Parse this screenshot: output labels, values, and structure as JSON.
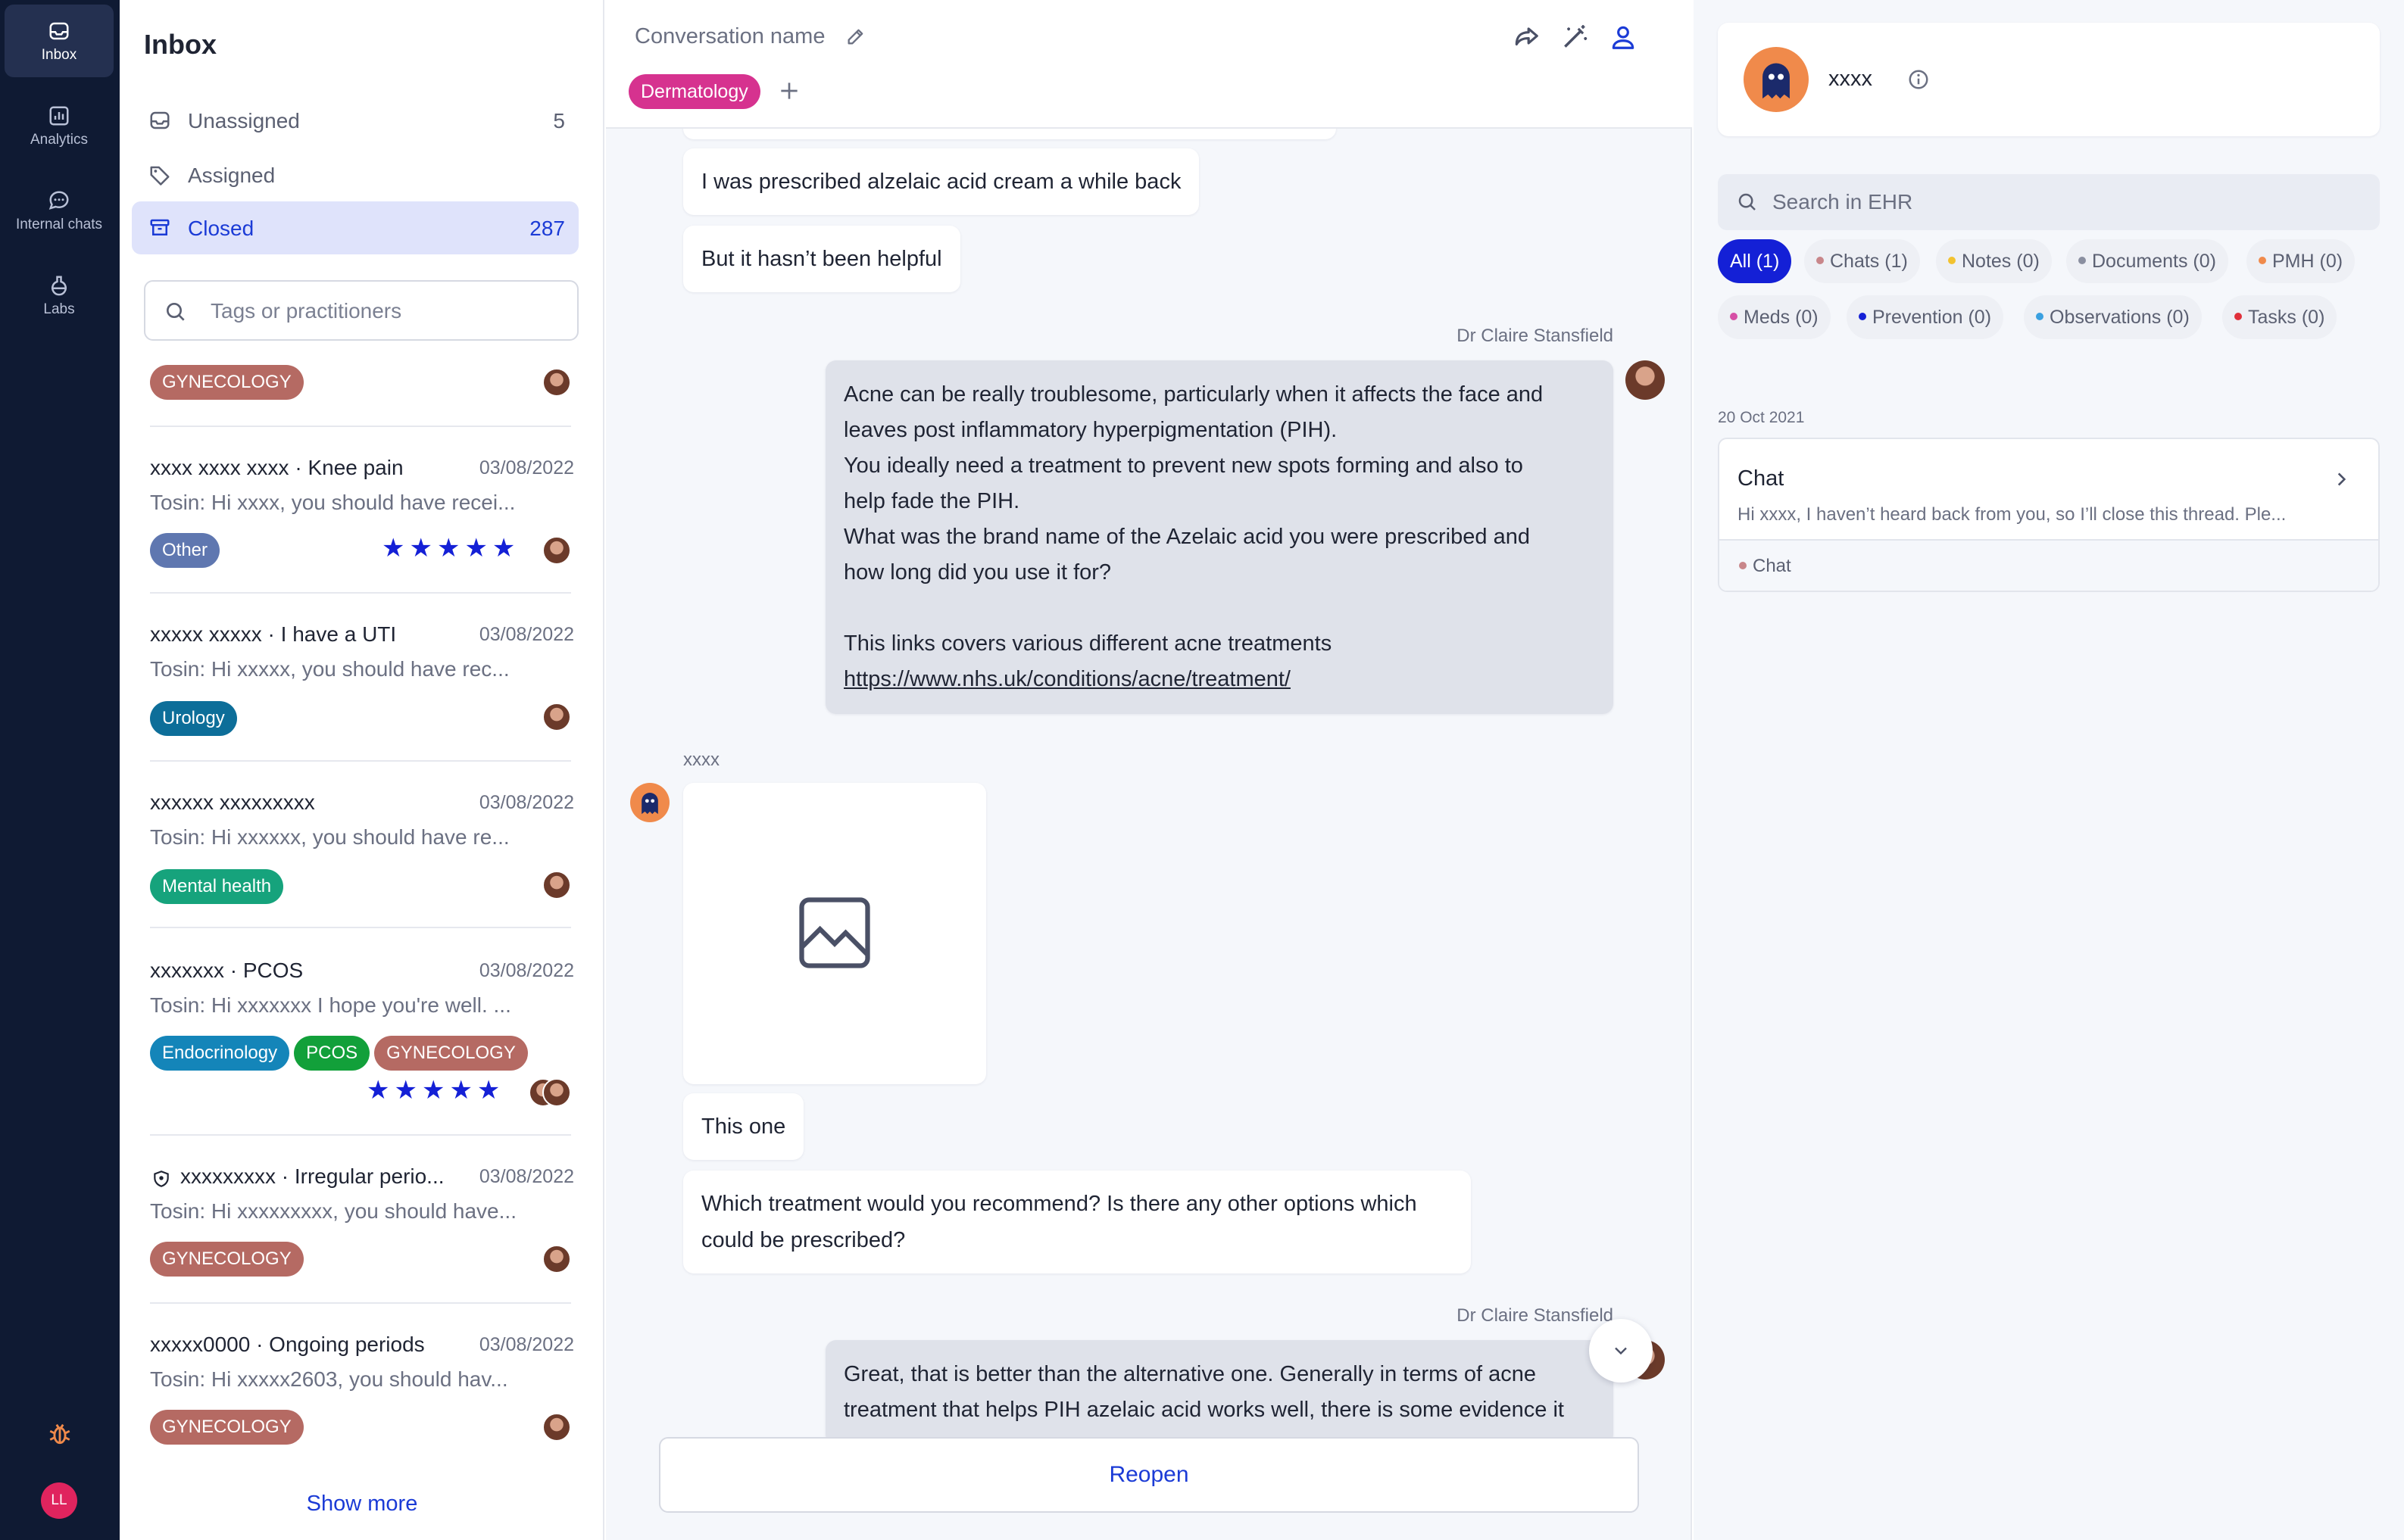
{
  "nav": {
    "items": [
      {
        "label": "Inbox",
        "icon": "inbox-icon",
        "active": true
      },
      {
        "label": "Analytics",
        "icon": "analytics-icon",
        "active": false
      },
      {
        "label": "Internal chats",
        "icon": "chat-bubble-icon",
        "active": false
      },
      {
        "label": "Labs",
        "icon": "flask-icon",
        "active": false
      }
    ],
    "user_initials": "LL",
    "colors": {
      "background": "#0f1a33",
      "active": "#243050",
      "avatar": "#e0245e"
    }
  },
  "inbox": {
    "title": "Inbox",
    "folders": [
      {
        "label": "Unassigned",
        "count": "5",
        "active": false
      },
      {
        "label": "Assigned",
        "count": "",
        "active": false
      },
      {
        "label": "Closed",
        "count": "287",
        "active": true
      }
    ],
    "search_placeholder": "Tags or practitioners",
    "top_partial_tag": "GYNECOLOGY",
    "conversations": [
      {
        "name": "xxxx xxxx xxxx · Knee pain",
        "date": "03/08/2022",
        "preview": "Tosin: Hi xxxx, you should have recei...",
        "tags": [
          "Other"
        ],
        "stars": "★★★★★"
      },
      {
        "name": "xxxxx xxxxx · I have a UTI",
        "date": "03/08/2022",
        "preview": "Tosin: Hi xxxxx, you should have rec...",
        "tags": [
          "Urology"
        ],
        "stars": ""
      },
      {
        "name": "xxxxxx xxxxxxxxx",
        "date": "03/08/2022",
        "preview": "Tosin: Hi xxxxxx, you should have re...",
        "tags": [
          "Mental health"
        ],
        "stars": ""
      },
      {
        "name": "xxxxxxx · PCOS",
        "date": "03/08/2022",
        "preview": "Tosin: Hi xxxxxxx I hope you're well. ...",
        "tags": [
          "Endocrinology",
          "PCOS",
          "GYNECOLOGY"
        ],
        "stars": "★★★★★"
      },
      {
        "name": "xxxxxxxxx · Irregular perio...",
        "date": "03/08/2022",
        "preview": "Tosin: Hi xxxxxxxxx, you should have...",
        "tags": [
          "GYNECOLOGY"
        ],
        "stars": ""
      },
      {
        "name": "xxxxx0000 · Ongoing periods",
        "date": "03/08/2022",
        "preview": "Tosin: Hi xxxxx2603, you should hav...",
        "tags": [
          "GYNECOLOGY"
        ],
        "stars": ""
      }
    ],
    "show_more": "Show more",
    "tag_colors": {
      "GYNECOLOGY": "#b56a63",
      "Other": "#5f77b0",
      "Urology": "#0d6e99",
      "Mental health": "#16a37c",
      "Endocrinology": "#1485b9",
      "PCOS": "#12a03a"
    }
  },
  "conversation": {
    "name": "Conversation name",
    "tag": "Dermatology",
    "tag_color": "#d6328f",
    "header_icons": [
      "share-icon",
      "magic-wand-icon",
      "user-icon"
    ],
    "messages": {
      "m1": "I was prescribed alzelaic acid cream a while back",
      "m2": "But it hasn’t been helpful",
      "doctor1_name": "Dr Claire Stansfield",
      "doctor1_lines": [
        "Acne can be really troublesome, particularly when it affects the face and",
        "leaves post inflammatory hyperpigmentation (PIH).",
        "You ideally need a treatment to prevent new spots forming and also to",
        "help fade the PIH.",
        "What was the brand name of the Azelaic acid you were prescribed and",
        "how long did you use it for?",
        "",
        "This links covers various different acne treatments"
      ],
      "doctor1_link": "https://www.nhs.uk/conditions/acne/treatment/",
      "patient_name": "xxxx",
      "m3": "This one",
      "m4_lines": [
        "Which treatment would you recommend? Is there any other options which",
        "could be prescribed?"
      ],
      "doctor2_name": "Dr Claire Stansfield",
      "doctor2_lines": [
        "Great, that is better than the alternative one. Generally in terms of acne",
        "treatment that helps PIH azelaic acid works well, there is some evidence it"
      ]
    },
    "reopen_label": "Reopen"
  },
  "ehr": {
    "patient_name": "xxxx",
    "search_placeholder": "Search in EHR",
    "filters": [
      {
        "label": "All (1)",
        "active": true,
        "dot": ""
      },
      {
        "label": "Chats (1)",
        "active": false,
        "dot": "#c8868a"
      },
      {
        "label": "Notes (0)",
        "active": false,
        "dot": "#f2c230"
      },
      {
        "label": "Documents (0)",
        "active": false,
        "dot": "#8a8fa0"
      },
      {
        "label": "PMH (0)",
        "active": false,
        "dot": "#f08a4b"
      },
      {
        "label": "Meds (0)",
        "active": false,
        "dot": "#d64fa6"
      },
      {
        "label": "Prevention (0)",
        "active": false,
        "dot": "#1420d6"
      },
      {
        "label": "Observations (0)",
        "active": false,
        "dot": "#3aa0e0"
      },
      {
        "label": "Tasks (0)",
        "active": false,
        "dot": "#e0303b"
      }
    ],
    "date": "20 Oct 2021",
    "card": {
      "title": "Chat",
      "preview": "Hi xxxx, I haven’t heard back from you, so I’ll close this thread. Ple...",
      "tag": "Chat"
    }
  }
}
